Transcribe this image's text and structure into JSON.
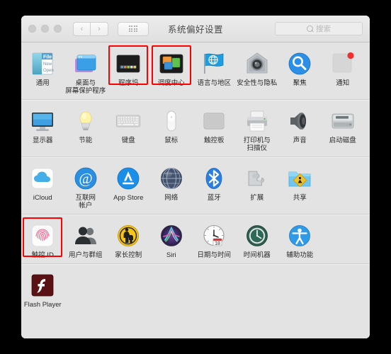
{
  "window": {
    "title": "系统偏好设置",
    "traffic_lights": [
      "close",
      "minimize",
      "zoom"
    ],
    "nav": {
      "back_label": "‹",
      "forward_label": "›",
      "showall_label": "grid-icon"
    },
    "search": {
      "placeholder": "搜索",
      "value": ""
    }
  },
  "colors": {
    "highlight": "#ff0000",
    "window_bg": "#e3e3e3",
    "titlebar_bg": "#e8e8e8",
    "desktop_bg": "#000000",
    "label_text": "#2a2a2a"
  },
  "rows": [
    {
      "items": [
        {
          "label": "通用",
          "icon": "general-icon",
          "highlighted": false
        },
        {
          "label": "桌面与\n屏幕保护程序",
          "icon": "desktop-screensaver-icon",
          "highlighted": false
        },
        {
          "label": "程序坞",
          "icon": "dock-icon",
          "highlighted": true
        },
        {
          "label": "调度中心",
          "icon": "mission-control-icon",
          "highlighted": true
        },
        {
          "label": "语言与地区",
          "icon": "language-region-icon",
          "highlighted": false
        },
        {
          "label": "安全性与隐私",
          "icon": "security-privacy-icon",
          "highlighted": false
        },
        {
          "label": "聚焦",
          "icon": "spotlight-icon",
          "highlighted": false
        },
        {
          "label": "通知",
          "icon": "notifications-icon",
          "highlighted": false
        }
      ]
    },
    {
      "items": [
        {
          "label": "显示器",
          "icon": "displays-icon",
          "highlighted": false
        },
        {
          "label": "节能",
          "icon": "energy-saver-icon",
          "highlighted": false
        },
        {
          "label": "键盘",
          "icon": "keyboard-icon",
          "highlighted": false
        },
        {
          "label": "鼠标",
          "icon": "mouse-icon",
          "highlighted": false
        },
        {
          "label": "触控板",
          "icon": "trackpad-icon",
          "highlighted": false
        },
        {
          "label": "打印机与\n扫描仪",
          "icon": "printers-scanners-icon",
          "highlighted": false
        },
        {
          "label": "声音",
          "icon": "sound-icon",
          "highlighted": false
        },
        {
          "label": "启动磁盘",
          "icon": "startup-disk-icon",
          "highlighted": false
        }
      ]
    },
    {
      "items": [
        {
          "label": "iCloud",
          "icon": "icloud-icon",
          "highlighted": false
        },
        {
          "label": "互联网\n帐户",
          "icon": "internet-accounts-icon",
          "highlighted": false
        },
        {
          "label": "App Store",
          "icon": "app-store-icon",
          "highlighted": false
        },
        {
          "label": "网络",
          "icon": "network-icon",
          "highlighted": false
        },
        {
          "label": "蓝牙",
          "icon": "bluetooth-icon",
          "highlighted": false
        },
        {
          "label": "扩展",
          "icon": "extensions-icon",
          "highlighted": false
        },
        {
          "label": "共享",
          "icon": "sharing-icon",
          "highlighted": false
        }
      ]
    },
    {
      "items": [
        {
          "label": "触控 ID",
          "icon": "touch-id-icon",
          "highlighted": true
        },
        {
          "label": "用户与群组",
          "icon": "users-groups-icon",
          "highlighted": false
        },
        {
          "label": "家长控制",
          "icon": "parental-controls-icon",
          "highlighted": false
        },
        {
          "label": "Siri",
          "icon": "siri-icon",
          "highlighted": false
        },
        {
          "label": "日期与时间",
          "icon": "date-time-icon",
          "highlighted": false
        },
        {
          "label": "时间机器",
          "icon": "time-machine-icon",
          "highlighted": false
        },
        {
          "label": "辅助功能",
          "icon": "accessibility-icon",
          "highlighted": false
        }
      ]
    },
    {
      "items": [
        {
          "label": "Flash Player",
          "icon": "flash-player-icon",
          "highlighted": false
        }
      ]
    }
  ]
}
